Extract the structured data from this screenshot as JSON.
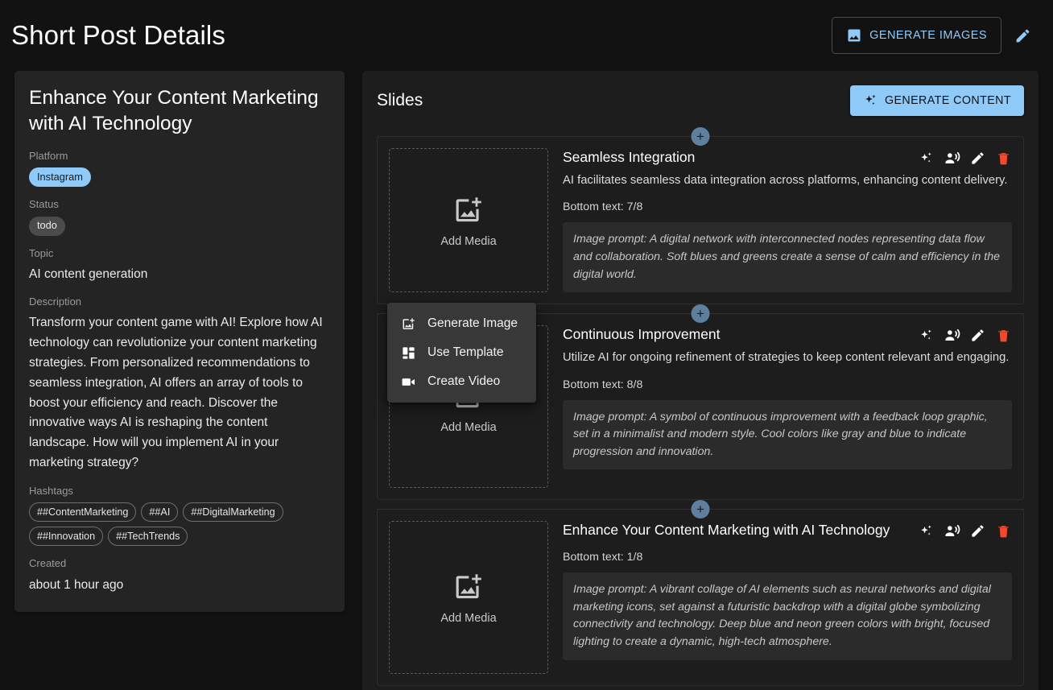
{
  "header": {
    "title": "Short Post Details",
    "generate_images_label": "GENERATE IMAGES",
    "edit_icon": "pencil-icon",
    "image_icon": "image-icon"
  },
  "post": {
    "title": "Enhance Your Content Marketing with AI Technology",
    "platform_label": "Platform",
    "platform_value": "Instagram",
    "status_label": "Status",
    "status_value": "todo",
    "topic_label": "Topic",
    "topic_value": "AI content generation",
    "description_label": "Description",
    "description_value": "Transform your content game with AI! Explore how AI technology can revolutionize your content marketing strategies. From personalized recommendations to seamless integration, AI offers an array of tools to boost your efficiency and reach. Discover the innovative ways AI is reshaping the content landscape. How will you implement AI in your marketing strategy?",
    "hashtags_label": "Hashtags",
    "hashtags": [
      "##ContentMarketing",
      "##AI",
      "##DigitalMarketing",
      "##Innovation",
      "##TechTrends"
    ],
    "created_label": "Created",
    "created_value": "about 1 hour ago"
  },
  "slides_panel": {
    "title": "Slides",
    "generate_content_label": "GENERATE CONTENT",
    "add_slide_label": "+",
    "media_placeholder_label": "Add Media",
    "slides": [
      {
        "title": "Seamless Integration",
        "description": "AI facilitates seamless data integration across platforms, enhancing content delivery.",
        "bottom_text": "Bottom text: 7/8",
        "image_prompt": "Image prompt: A digital network with interconnected nodes representing data flow and collaboration. Soft blues and greens create a sense of calm and efficiency in the digital world.",
        "media_label": "Add Media"
      },
      {
        "title": "Continuous Improvement",
        "description": "Utilize AI for ongoing refinement of strategies to keep content relevant and engaging.",
        "bottom_text": "Bottom text: 8/8",
        "image_prompt": "Image prompt: A symbol of continuous improvement with a feedback loop graphic, set in a minimalist and modern style. Cool colors like gray and blue to indicate progression and innovation.",
        "media_label": "Add Media"
      },
      {
        "title": "Enhance Your Content Marketing with AI Technology",
        "description": "",
        "bottom_text": "Bottom text: 1/8",
        "image_prompt": "Image prompt: A vibrant collage of AI elements such as neural networks and digital marketing icons, set against a futuristic backdrop with a digital globe symbolizing connectivity and technology. Deep blue and neon green colors with bright, focused lighting to create a dynamic, high-tech atmosphere.",
        "media_label": "Add Media"
      }
    ],
    "slide_actions": [
      "sparkle-icon",
      "voice-over-icon",
      "pencil-icon",
      "trash-icon"
    ]
  },
  "context_menu": {
    "items": [
      {
        "label": "Generate Image",
        "icon": "add-image-icon"
      },
      {
        "label": "Use Template",
        "icon": "template-grid-icon"
      },
      {
        "label": "Create Video",
        "icon": "video-camera-icon"
      }
    ]
  },
  "colors": {
    "background": "#121212",
    "card": "#242424",
    "panel": "#1d1d1d",
    "accent": "#90caf9",
    "danger": "#f4492d",
    "add_badge": "#5e7f9e",
    "muted_text": "#9a9a9a"
  }
}
